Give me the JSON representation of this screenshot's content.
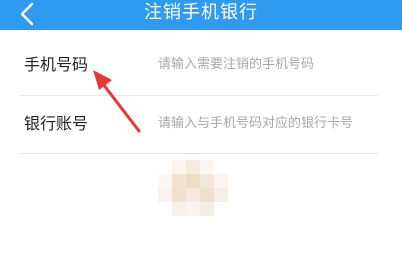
{
  "header": {
    "title": "注销手机银行",
    "back_icon": "chevron-left-icon",
    "background_color": "#2f9bf0"
  },
  "form": {
    "phone": {
      "label": "手机号码",
      "placeholder": "请输入需要注销的手机号码",
      "value": ""
    },
    "account": {
      "label": "银行账号",
      "placeholder": "请输入与手机号码对应的银行卡号",
      "value": ""
    }
  },
  "annotation": {
    "arrow_color": "#e53935",
    "icon": "red-pointer-arrow-icon"
  },
  "blurred_region": {
    "icon": "mosaic-pixelated-region"
  }
}
